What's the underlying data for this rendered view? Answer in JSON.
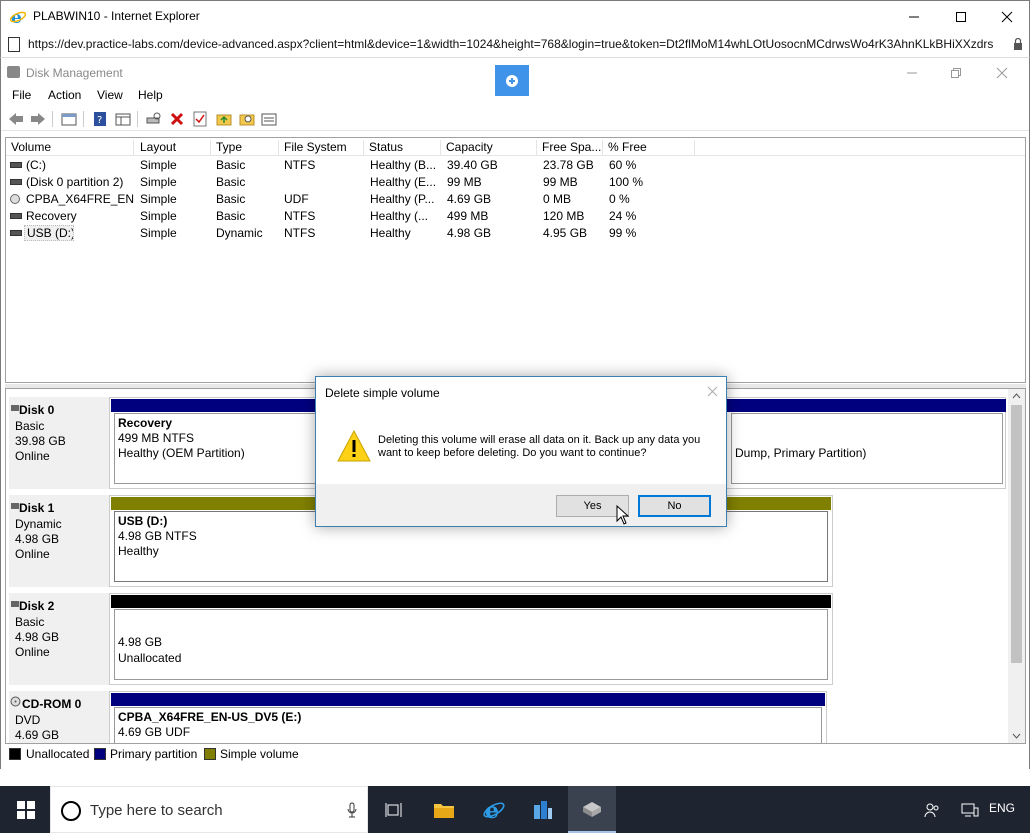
{
  "ie": {
    "title": "PLABWIN10 - Internet Explorer",
    "url": "https://dev.practice-labs.com/device-advanced.aspx?client=html&device=1&width=1024&height=768&login=true&token=Dt2flMoM14whLOtUosocnMCdrwsWo4rK3AhnKLkBHiXXzdrs"
  },
  "dm": {
    "title": "Disk Management",
    "menu": [
      "File",
      "Action",
      "View",
      "Help"
    ]
  },
  "columns": [
    "Volume",
    "Layout",
    "Type",
    "File System",
    "Status",
    "Capacity",
    "Free Spa...",
    "% Free"
  ],
  "volumes": [
    {
      "volume": "(C:)",
      "layout": "Simple",
      "type": "Basic",
      "fs": "NTFS",
      "status": "Healthy (B...",
      "capacity": "39.40 GB",
      "free": "23.78 GB",
      "pct": "60 %",
      "icon": "disk"
    },
    {
      "volume": "(Disk 0 partition 2)",
      "layout": "Simple",
      "type": "Basic",
      "fs": "",
      "status": "Healthy (E...",
      "capacity": "99 MB",
      "free": "99 MB",
      "pct": "100 %",
      "icon": "disk"
    },
    {
      "volume": "CPBA_X64FRE_EN-...",
      "layout": "Simple",
      "type": "Basic",
      "fs": "UDF",
      "status": "Healthy (P...",
      "capacity": "4.69 GB",
      "free": "0 MB",
      "pct": "0 %",
      "icon": "cd"
    },
    {
      "volume": "Recovery",
      "layout": "Simple",
      "type": "Basic",
      "fs": "NTFS",
      "status": "Healthy (...",
      "capacity": "499 MB",
      "free": "120 MB",
      "pct": "24 %",
      "icon": "disk"
    },
    {
      "volume": "USB (D:)",
      "layout": "Simple",
      "type": "Dynamic",
      "fs": "NTFS",
      "status": "Healthy",
      "capacity": "4.98 GB",
      "free": "4.95 GB",
      "pct": "99 %",
      "icon": "disk"
    }
  ],
  "disks": {
    "disk0": {
      "name": "Disk 0",
      "type": "Basic",
      "size": "39.98 GB",
      "state": "Online",
      "p1": {
        "name": "Recovery",
        "size": "499 MB NTFS",
        "status": "Healthy (OEM Partition)"
      },
      "p_right_status": "Dump, Primary Partition)"
    },
    "disk1": {
      "name": "Disk 1",
      "type": "Dynamic",
      "size": "4.98 GB",
      "state": "Online",
      "p1": {
        "name": "USB  (D:)",
        "size": "4.98 GB NTFS",
        "status": "Healthy"
      }
    },
    "disk2": {
      "name": "Disk 2",
      "type": "Basic",
      "size": "4.98 GB",
      "state": "Online",
      "p1": {
        "size": "4.98 GB",
        "status": "Unallocated"
      }
    },
    "cdrom0": {
      "name": "CD-ROM 0",
      "type": "DVD",
      "size": "4.69 GB",
      "p1": {
        "name": "CPBA_X64FRE_EN-US_DV5  (E:)",
        "size": "4.69 GB UDF"
      }
    }
  },
  "legend": [
    {
      "label": "Unallocated",
      "color": "#000000"
    },
    {
      "label": "Primary partition",
      "color": "#00007f"
    },
    {
      "label": "Simple volume",
      "color": "#808000"
    }
  ],
  "dialog": {
    "title": "Delete simple volume",
    "message": "Deleting this volume will erase all data on it. Back up any data you want to keep before deleting. Do you want to continue?",
    "yes": "Yes",
    "no": "No"
  },
  "taskbar": {
    "search_placeholder": "Type here to search",
    "lang": "ENG"
  },
  "colors": {
    "primary": "#00007f",
    "simple": "#808000",
    "accent": "#0078d7"
  }
}
